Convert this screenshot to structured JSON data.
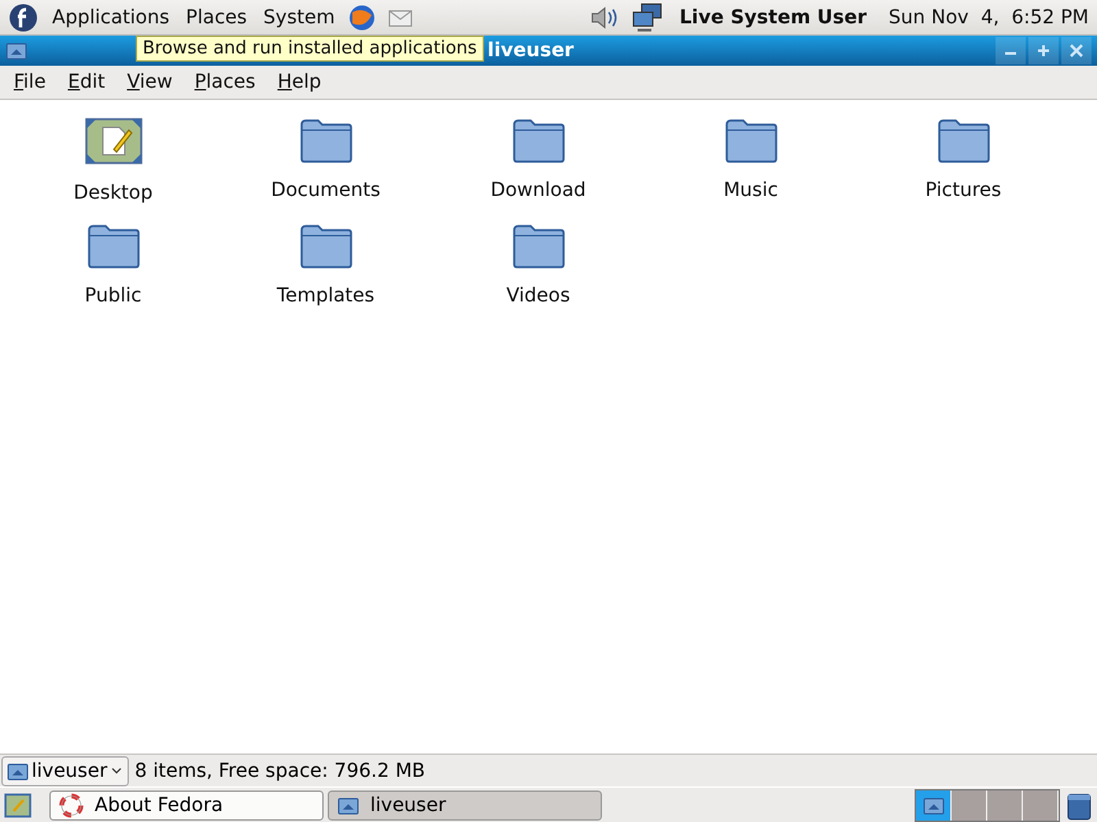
{
  "top_panel": {
    "menus": [
      "Applications",
      "Places",
      "System"
    ],
    "user": "Live System User",
    "clock": "Sun Nov  4,  6:52 PM"
  },
  "tooltip": "Browse and run installed applications",
  "window": {
    "title": "liveuser"
  },
  "menubar": [
    "File",
    "Edit",
    "View",
    "Places",
    "Help"
  ],
  "files": [
    {
      "name": "Desktop",
      "kind": "desktop"
    },
    {
      "name": "Documents",
      "kind": "folder"
    },
    {
      "name": "Download",
      "kind": "folder"
    },
    {
      "name": "Music",
      "kind": "folder"
    },
    {
      "name": "Pictures",
      "kind": "folder"
    },
    {
      "name": "Public",
      "kind": "folder"
    },
    {
      "name": "Templates",
      "kind": "folder"
    },
    {
      "name": "Videos",
      "kind": "folder"
    }
  ],
  "status_bar": {
    "location": "liveuser",
    "info": "8 items, Free space: 796.2 MB"
  },
  "taskbar": [
    {
      "label": "About Fedora",
      "kind": "help",
      "selected": false
    },
    {
      "label": "liveuser",
      "kind": "folder",
      "selected": true
    }
  ],
  "workspaces": [
    {
      "selected": true
    },
    {
      "selected": false
    },
    {
      "selected": false
    },
    {
      "selected": false
    }
  ]
}
